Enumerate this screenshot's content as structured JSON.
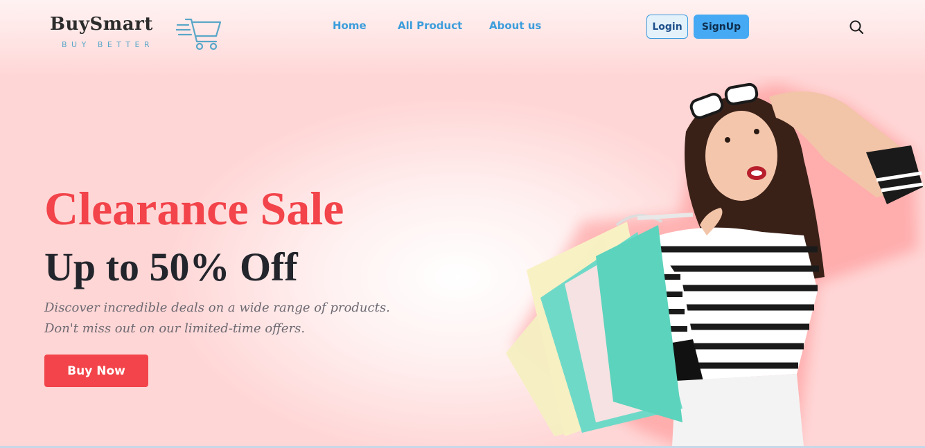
{
  "brand": {
    "name": "BuySmart",
    "tagline": "BUY BETTER",
    "logo_icon": "shopping-cart-icon",
    "color_dark": "#2b2b2b",
    "color_accent": "#5aa7c8"
  },
  "nav": {
    "items": [
      {
        "label": "Home"
      },
      {
        "label": "All Product"
      },
      {
        "label": "About us"
      }
    ],
    "color": "#3c9ddb"
  },
  "auth": {
    "login_label": "Login",
    "signup_label": "SignUp",
    "signup_color": "#45a9f3"
  },
  "search": {
    "icon": "search-icon"
  },
  "hero": {
    "title": "Clearance Sale",
    "subtitle": "Up to 50% Off",
    "description": "Discover incredible deals on a wide range of products. Don't miss out on our limited-time offers.",
    "cta_label": "Buy Now",
    "title_color": "#f2444a",
    "image": "woman-with-shopping-bags"
  }
}
